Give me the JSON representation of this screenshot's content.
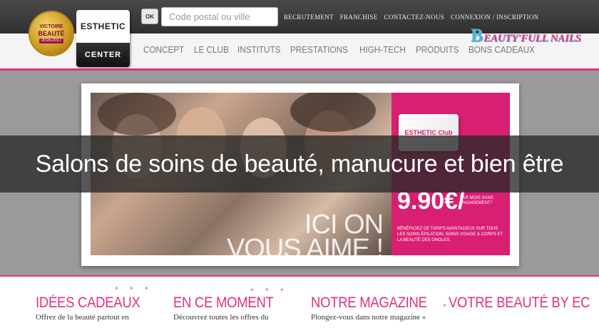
{
  "header": {
    "award": {
      "line1": "VICTOIRE",
      "line2": "BEAUTÉ",
      "line3": "2016-2017"
    },
    "logo": {
      "top": "ESTHETIC",
      "bottom": "CENTER"
    },
    "search": {
      "ok_label": "OK",
      "placeholder": "Code postal ou ville"
    },
    "top_links": [
      "RECRUTEMENT",
      "FRANCHISE",
      "CONTACTEZ-NOUS",
      "CONNEXION / INSCRIPTION"
    ],
    "main_nav": [
      "CONCEPT",
      "LE CLUB",
      "INSTITUTS",
      "PRESTATIONS",
      "HIGH-TECH",
      "PRODUITS",
      "BONS CADEAUX"
    ],
    "partner_logo": {
      "initial": "B",
      "text": "EAUTY'FULL NAILS"
    }
  },
  "hero": {
    "card_label": "ESTHETIC Club",
    "price": "9.90€",
    "price_suffix": "/",
    "per_month": "PAR MOIS SANS ENGAGEMENT.*",
    "benefits": "BÉNÉFICIEZ DE TARIFS AVANTAGEUX SUR TOUS LES SOINS ÉPILATION, SOINS VISAGE & CORPS ET LA BEAUTÉ DES ONGLES.",
    "slogan_line1": "ICI ON",
    "slogan_line2": "VOUS AIME !"
  },
  "banner": {
    "title": "Salons de soins de beauté, manucure et bien être"
  },
  "footer": {
    "columns": [
      {
        "title": "IDÉES CADEAUX",
        "text": "Offrez de la beauté partout en"
      },
      {
        "title": "EN CE MOMENT",
        "text": "Découvrez toutes les offres du"
      },
      {
        "title": "NOTRE MAGAZINE",
        "text": "Plongez-vous dans notre magazine «"
      },
      {
        "title": "VOTRE BEAUTÉ BY EC",
        "text": ""
      }
    ]
  },
  "colors": {
    "brand_pink": "#e0327f",
    "header_dark": "#2f2f2f",
    "panel_pink": "#d91f72"
  }
}
